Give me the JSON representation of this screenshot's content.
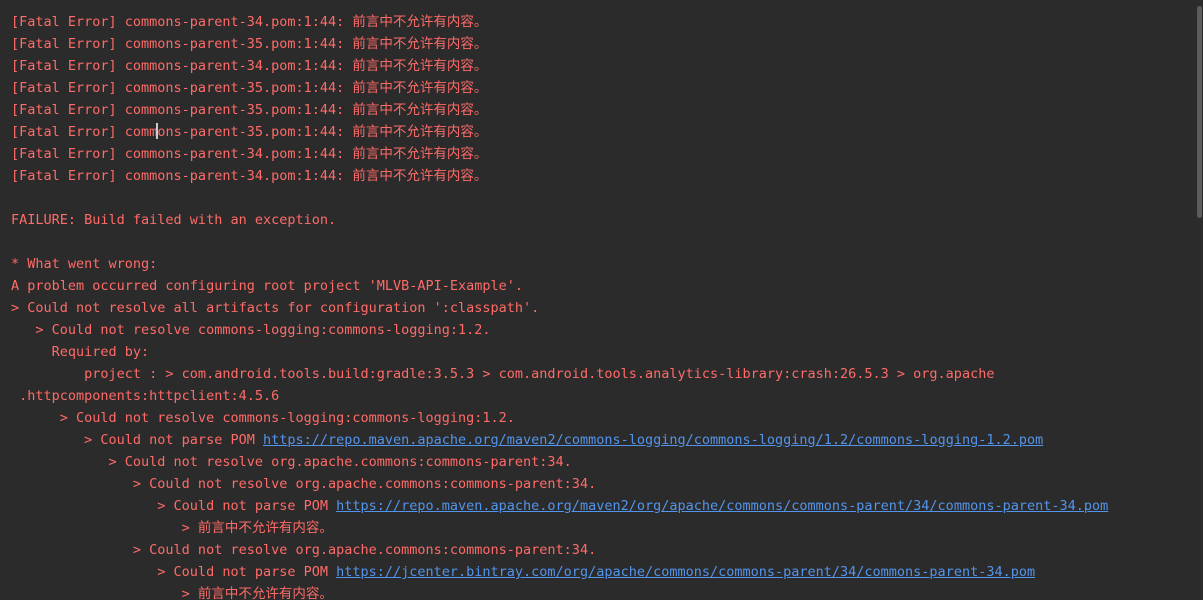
{
  "console": {
    "lines": [
      "",
      "[Fatal Error] commons-parent-34.pom:1:44: 前言中不允许有内容。",
      "[Fatal Error] commons-parent-35.pom:1:44: 前言中不允许有内容。",
      "[Fatal Error] commons-parent-34.pom:1:44: 前言中不允许有内容。",
      "[Fatal Error] commons-parent-35.pom:1:44: 前言中不允许有内容。",
      "[Fatal Error] commons-parent-35.pom:1:44: 前言中不允许有内容。",
      {
        "before_caret": "[Fatal Error] comm",
        "after_caret": "ons-parent-35.pom:1:44: 前言中不允许有内容。"
      },
      "[Fatal Error] commons-parent-34.pom:1:44: 前言中不允许有内容。",
      "[Fatal Error] commons-parent-34.pom:1:44: 前言中不允许有内容。",
      "",
      "FAILURE: Build failed with an exception.",
      "",
      "* What went wrong:",
      "A problem occurred configuring root project 'MLVB-API-Example'.",
      "> Could not resolve all artifacts for configuration ':classpath'.",
      "   > Could not resolve commons-logging:commons-logging:1.2.",
      "     Required by:",
      "         project : > com.android.tools.build:gradle:3.5.3 > com.android.tools.analytics-library:crash:26.5.3 > org.apache",
      " .httpcomponents:httpclient:4.5.6",
      "      > Could not resolve commons-logging:commons-logging:1.2.",
      {
        "prefix": "         > Could not parse POM ",
        "link": "https://repo.maven.apache.org/maven2/commons-logging/commons-logging/1.2/commons-logging-1.2.pom"
      },
      "            > Could not resolve org.apache.commons:commons-parent:34.",
      "               > Could not resolve org.apache.commons:commons-parent:34.",
      {
        "prefix": "                  > Could not parse POM ",
        "link": "https://repo.maven.apache.org/maven2/org/apache/commons/commons-parent/34/commons-parent-34.pom"
      },
      "                     > 前言中不允许有内容。",
      "               > Could not resolve org.apache.commons:commons-parent:34.",
      {
        "prefix": "                  > Could not parse POM ",
        "link": "https://jcenter.bintray.com/org/apache/commons/commons-parent/34/commons-parent-34.pom"
      },
      "                     > 前言中不允许有内容。"
    ]
  },
  "colors": {
    "background": "#2b2b2b",
    "error_text": "#ff6b68",
    "link": "#5394ec",
    "scrollbar_thumb": "#5a5d5f"
  }
}
